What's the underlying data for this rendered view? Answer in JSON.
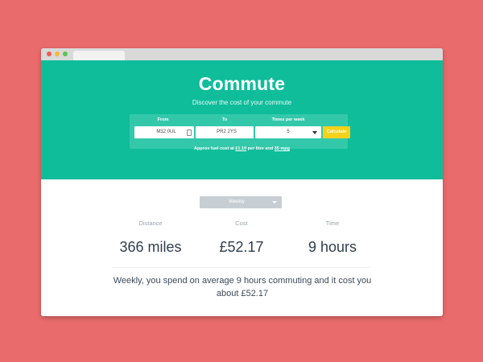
{
  "hero": {
    "title": "Commute",
    "subtitle": "Discover the cost of your commute"
  },
  "form": {
    "from_label": "From",
    "from_value": "M32 0UL",
    "to_label": "To",
    "to_value": "PR2 2YS",
    "times_label": "Times per week",
    "times_value": "5",
    "calculate_label": "Calculate",
    "fuel_prefix": "Approx fuel cost at",
    "fuel_price": "£1.10",
    "fuel_mid": "per litre and",
    "mpg": "35 mpg"
  },
  "period": {
    "selected": "Weekly"
  },
  "stats": {
    "distance_label": "Distance",
    "distance_value": "366 miles",
    "cost_label": "Cost",
    "cost_value": "£52.17",
    "time_label": "Time",
    "time_value": "9 hours"
  },
  "summary": "Weekly, you spend on average 9 hours commuting and it cost you about £52.17",
  "colors": {
    "background": "#ea6b6b",
    "accent": "#0fbd9b",
    "button": "#f4d21b"
  }
}
